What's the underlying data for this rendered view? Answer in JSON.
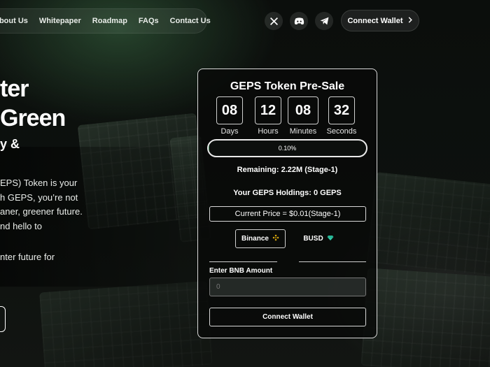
{
  "nav": {
    "links": [
      "About Us",
      "Whitepaper",
      "Roadmap",
      "FAQs",
      "Contact Us"
    ],
    "connect_label": "Connect Wallet",
    "socials": [
      "x-icon",
      "discord-icon",
      "telegram-icon"
    ]
  },
  "hero": {
    "line1": "ter",
    "line2": "Green",
    "line3": "y &",
    "para_lines": [
      "EPS) Token is your",
      "h GEPS, you’re not",
      "aner, greener future.",
      "nd hello to"
    ],
    "para2": "nter future for"
  },
  "presale": {
    "title": "GEPS Token Pre-Sale",
    "countdown": [
      {
        "value": "08",
        "label": "Days"
      },
      {
        "value": "12",
        "label": "Hours"
      },
      {
        "value": "08",
        "label": "Minutes"
      },
      {
        "value": "32",
        "label": "Seconds"
      }
    ],
    "progress_text": "0.10%",
    "progress_fraction": 0.001,
    "remaining": "Remaining: 2.22M (Stage-1)",
    "holdings": "Your GEPS Holdings: 0 GEPS",
    "price": "Current Price = $0.01(Stage-1)",
    "pay_options": [
      "Binance",
      "BUSD"
    ],
    "input_label": "Enter BNB Amount",
    "input_placeholder": "0",
    "connect_label": "Connect Wallet"
  },
  "colors": {
    "accent_green": "#3b8a55",
    "binance_yellow": "#f0b90b",
    "busd_teal": "#2fc7a5"
  }
}
